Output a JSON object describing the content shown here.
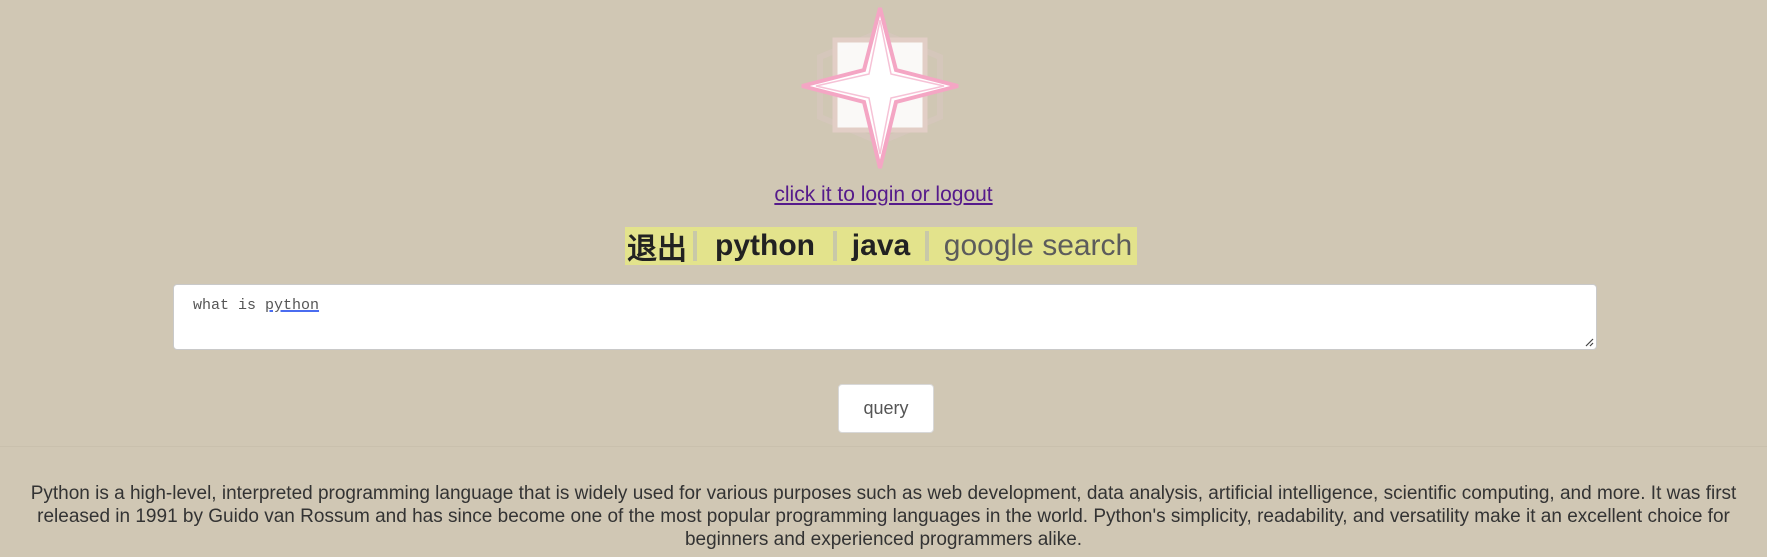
{
  "login": {
    "link_text": "click it to login or logout"
  },
  "tabs": [
    {
      "label": "退出"
    },
    {
      "label": "python"
    },
    {
      "label": "java"
    },
    {
      "label": "google search"
    }
  ],
  "query": {
    "prefix": "what is ",
    "spellchecked_word": "python"
  },
  "buttons": {
    "query_label": "query"
  },
  "answer": {
    "text": "Python is a high-level, interpreted programming language that is widely used for various purposes such as web development, data analysis, artificial intelligence, scientific computing, and more. It was first released in 1991 by Guido van Rossum and has since become one of the most popular programming languages in the world. Python's simplicity, readability, and versatility make it an excellent choice for beginners and experienced programmers alike."
  },
  "colors": {
    "background": "#d0c7b4",
    "tab_highlight": "#e3e38c",
    "star_outline": "#f4a6c4"
  },
  "icons": {
    "logo": "eight-point-star-icon"
  }
}
